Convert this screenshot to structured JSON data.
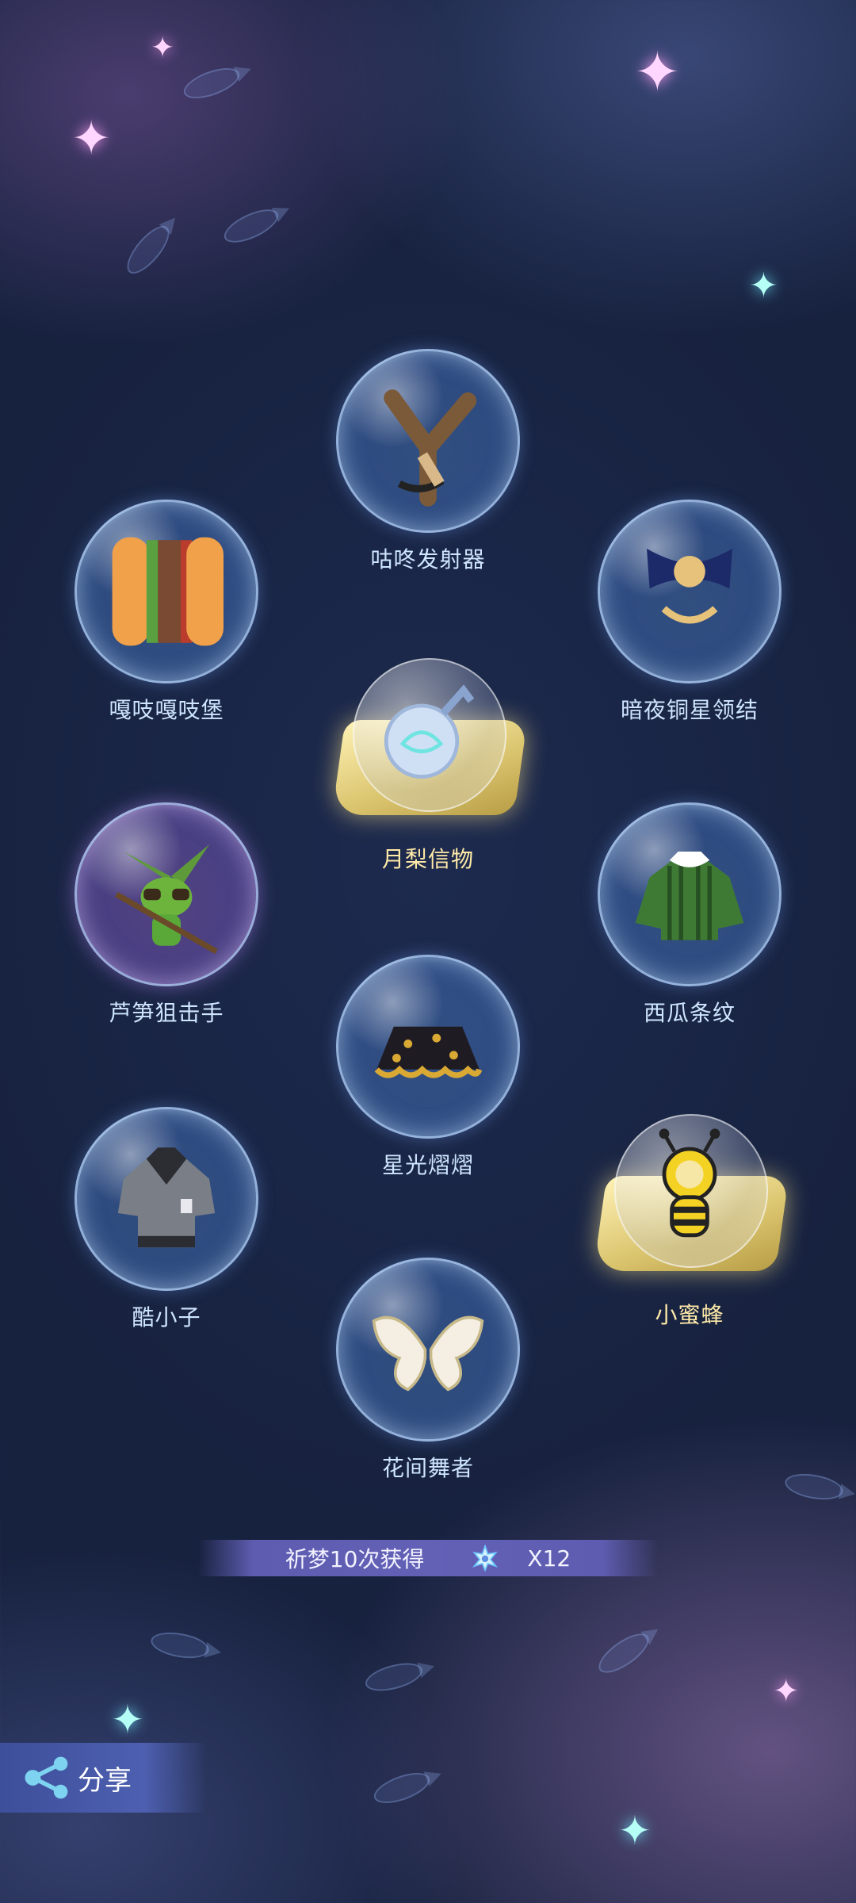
{
  "items": [
    {
      "label": "咕咚发射器",
      "icon": "slingshot-icon"
    },
    {
      "label": "嘎吱嘎吱堡",
      "icon": "burger-icon"
    },
    {
      "label": "暗夜铜星领结",
      "icon": "bow-tie-icon"
    },
    {
      "label": "月梨信物",
      "icon": "pear-token-icon"
    },
    {
      "label": "芦笋狙击手",
      "icon": "asparagus-sniper-icon"
    },
    {
      "label": "西瓜条纹",
      "icon": "striped-jacket-icon"
    },
    {
      "label": "星光熠熠",
      "icon": "star-skirt-icon"
    },
    {
      "label": "酷小子",
      "icon": "cool-shirt-icon"
    },
    {
      "label": "小蜜蜂",
      "icon": "bee-hat-icon"
    },
    {
      "label": "花间舞者",
      "icon": "butterfly-wings-icon"
    }
  ],
  "reward": {
    "text": "祈梦10次获得",
    "count": "X12",
    "icon": "dream-ticket-icon"
  },
  "share": {
    "label": "分享",
    "icon": "share-icon"
  }
}
